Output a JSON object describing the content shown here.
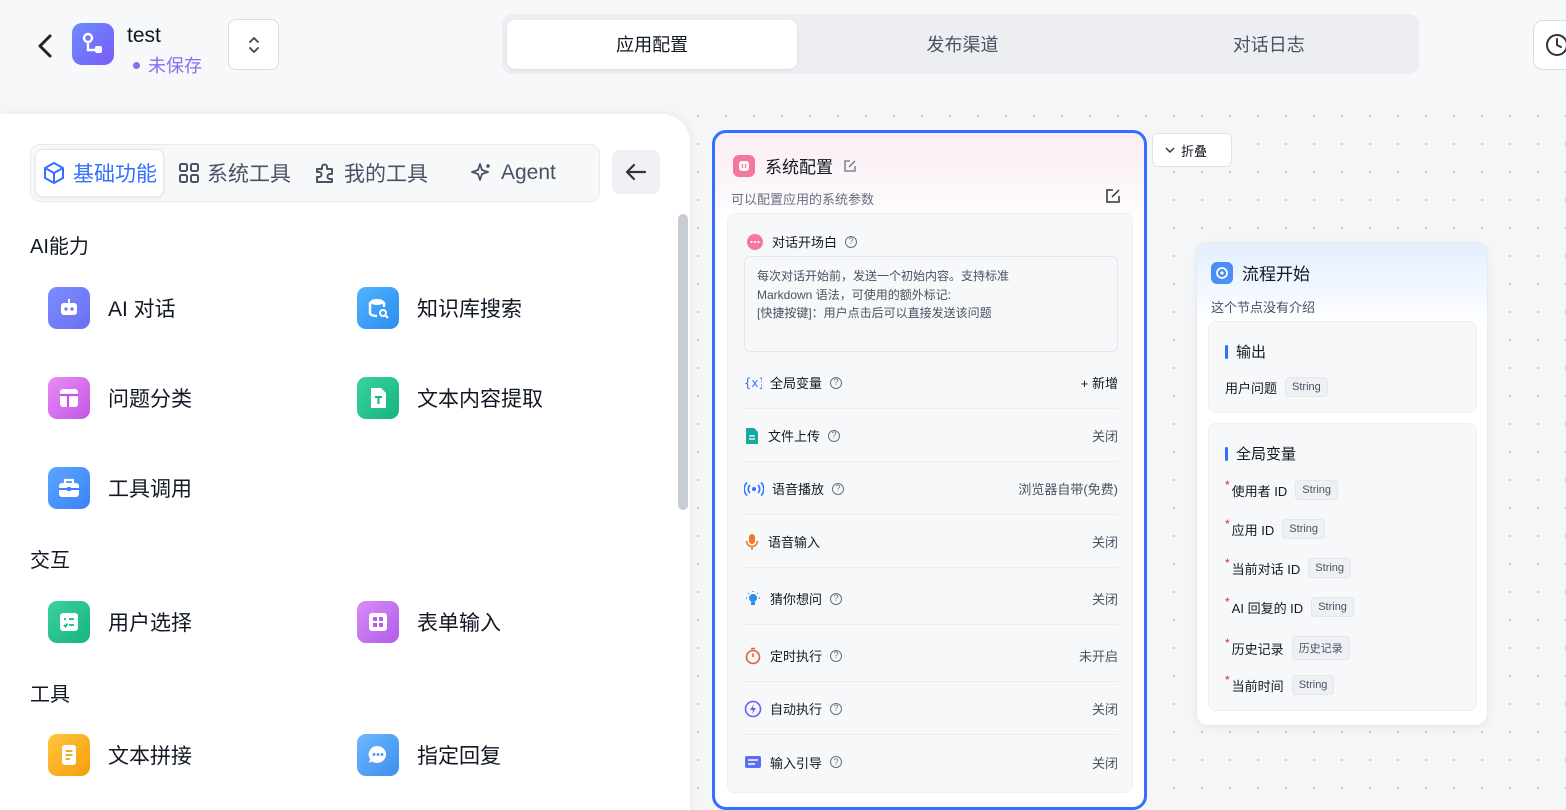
{
  "header": {
    "app_name": "test",
    "status": "未保存",
    "tabs": [
      "应用配置",
      "发布渠道",
      "对话日志"
    ]
  },
  "panel": {
    "categories": [
      "基础功能",
      "系统工具",
      "我的工具",
      "Agent"
    ],
    "sections": {
      "ai": "AI能力",
      "interaction": "交互",
      "tools": "工具"
    },
    "items": {
      "ai_chat": "AI 对话",
      "kb_search": "知识库搜索",
      "classify": "问题分类",
      "extract": "文本内容提取",
      "tool_call": "工具调用",
      "user_select": "用户选择",
      "form_input": "表单输入",
      "text_concat": "文本拼接",
      "reply": "指定回复"
    }
  },
  "system_node": {
    "title": "系统配置",
    "desc": "可以配置应用的系统参数",
    "welcome_label": "对话开场白",
    "welcome_text_1": "每次对话开始前，发送一个初始内容。支持标准",
    "welcome_text_2": "Markdown 语法，可使用的额外标记:",
    "welcome_text_3": "[快捷按键]：用户点击后可以直接发送该问题",
    "rows": [
      {
        "label": "全局变量",
        "value": "+ 新增"
      },
      {
        "label": "文件上传",
        "value": "关闭"
      },
      {
        "label": "语音播放",
        "value": "浏览器自带(免费)"
      },
      {
        "label": "语音输入",
        "value": "关闭"
      },
      {
        "label": "猜你想问",
        "value": "关闭"
      },
      {
        "label": "定时执行",
        "value": "未开启"
      },
      {
        "label": "自动执行",
        "value": "关闭"
      },
      {
        "label": "输入引导",
        "value": "关闭"
      }
    ]
  },
  "fold_button": "折叠",
  "start_node": {
    "title": "流程开始",
    "desc": "这个节点没有介绍",
    "output_title": "输出",
    "output_field": "用户问题",
    "output_type": "String",
    "global_title": "全局变量",
    "globals": [
      {
        "name": "使用者 ID",
        "type": "String"
      },
      {
        "name": "应用 ID",
        "type": "String"
      },
      {
        "name": "当前对话 ID",
        "type": "String"
      },
      {
        "name": "AI 回复的 ID",
        "type": "String"
      },
      {
        "name": "历史记录",
        "type": "历史记录"
      },
      {
        "name": "当前时间",
        "type": "String"
      }
    ]
  },
  "colors": {
    "primary": "#3370ff",
    "purple": "#8a6cf0",
    "pink": "#f4789d"
  }
}
